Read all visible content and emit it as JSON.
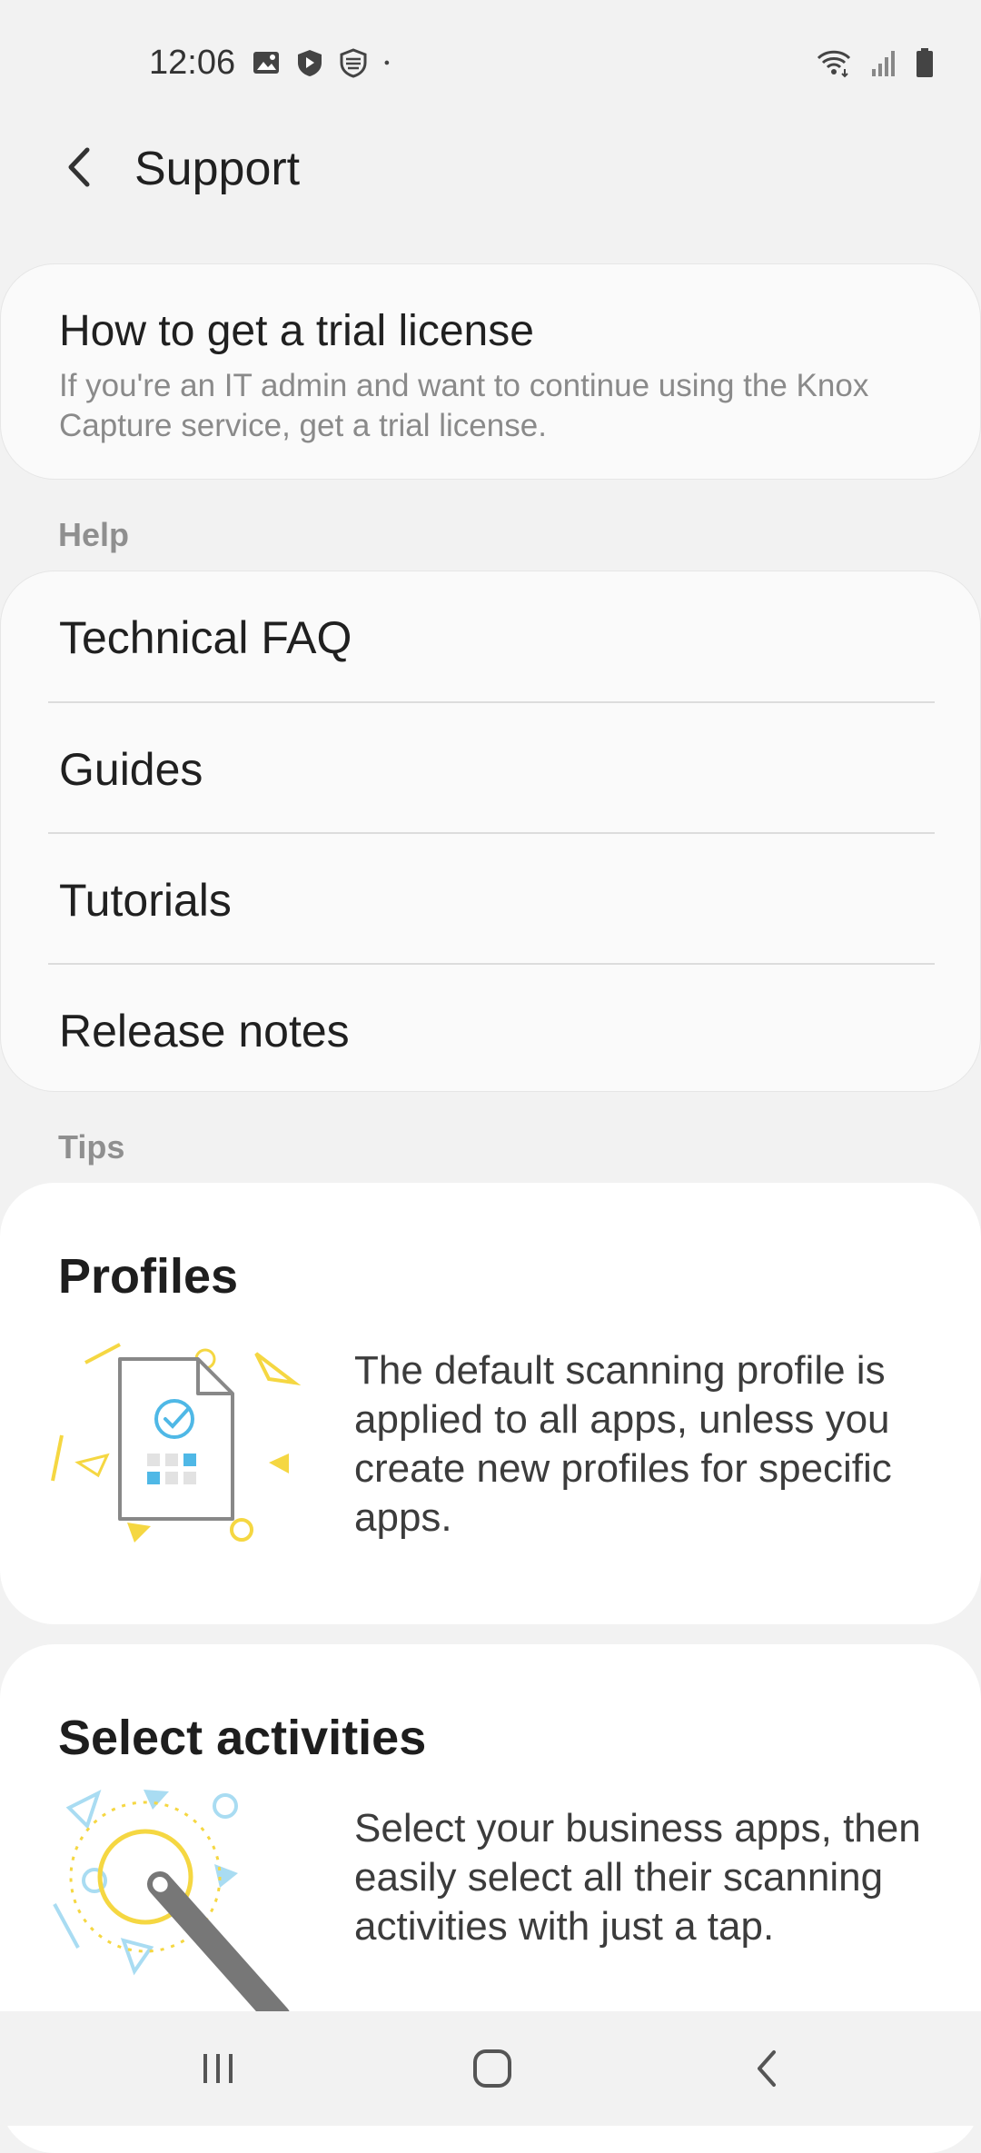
{
  "status_bar": {
    "time": "12:06",
    "left_icons": [
      "image-icon",
      "shield-icon",
      "knox-shield-icon",
      "dot-icon"
    ],
    "right_icons": [
      "wifi-icon",
      "signal-icon",
      "battery-icon"
    ]
  },
  "header": {
    "back_icon": "chevron-left-icon",
    "title": "Support"
  },
  "trial": {
    "title": "How to get a trial license",
    "description": "If you're an IT admin and want to continue using the Knox Capture service, get a trial license."
  },
  "help": {
    "label": "Help",
    "items": [
      {
        "label": "Technical FAQ"
      },
      {
        "label": "Guides"
      },
      {
        "label": "Tutorials"
      },
      {
        "label": "Release notes"
      }
    ]
  },
  "tips": {
    "label": "Tips",
    "cards": [
      {
        "title": "Profiles",
        "text": "The default scanning profile is applied to all apps, unless you create new profiles for specific apps.",
        "illustration": "document-check-illustration"
      },
      {
        "title": "Select activities",
        "text": "Select your business apps, then easily select all their scanning activities with just a tap.",
        "illustration": "tap-pen-illustration"
      }
    ]
  },
  "nav_bar": {
    "recents_icon": "recents-icon",
    "home_icon": "home-icon",
    "back_icon": "back-icon"
  },
  "colors": {
    "background": "#f2f2f2",
    "card": "#fafafa",
    "tip_card": "#ffffff",
    "accent_blue": "#4fb8e6",
    "accent_yellow": "#f5d742"
  }
}
